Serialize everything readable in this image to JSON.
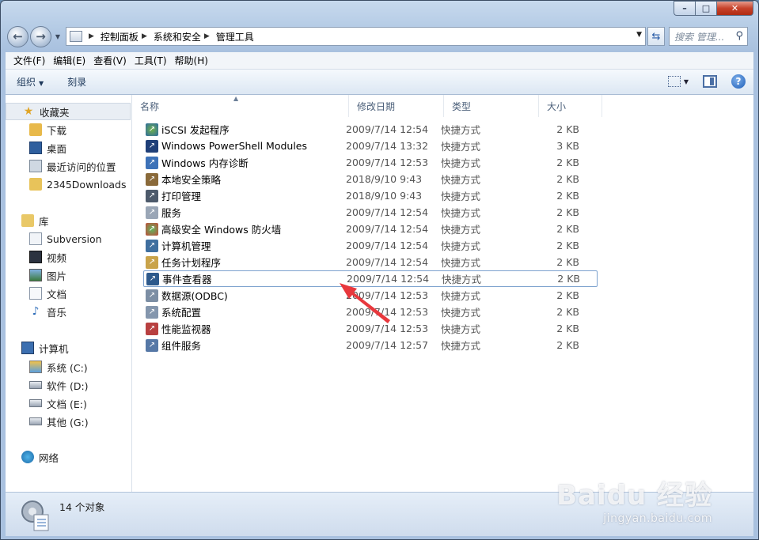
{
  "window": {
    "caption_min": "–",
    "caption_max": "□",
    "caption_close": "✕"
  },
  "address": {
    "crumbs": [
      "控制面板",
      "系统和安全",
      "管理工具"
    ],
    "search_placeholder": "搜索 管理..."
  },
  "menu": [
    "文件(F)",
    "编辑(E)",
    "查看(V)",
    "工具(T)",
    "帮助(H)"
  ],
  "commands": {
    "organize": "组织",
    "burn": "刻录"
  },
  "nav": {
    "favorites": "收藏夹",
    "favorites_items": [
      "下载",
      "桌面",
      "最近访问的位置",
      "2345Downloads"
    ],
    "libraries": "库",
    "libraries_items": [
      "Subversion",
      "视频",
      "图片",
      "文档",
      "音乐"
    ],
    "computer": "计算机",
    "computer_items": [
      "系统 (C:)",
      "软件 (D:)",
      "文档 (E:)",
      "其他 (G:)"
    ],
    "network": "网络"
  },
  "columns": [
    "名称",
    "修改日期",
    "类型",
    "大小"
  ],
  "files": [
    {
      "name": "iSCSI 发起程序",
      "date": "2009/7/14 12:54",
      "type": "快捷方式",
      "size": "2 KB"
    },
    {
      "name": "Windows PowerShell Modules",
      "date": "2009/7/14 13:32",
      "type": "快捷方式",
      "size": "3 KB"
    },
    {
      "name": "Windows 内存诊断",
      "date": "2009/7/14 12:53",
      "type": "快捷方式",
      "size": "2 KB"
    },
    {
      "name": "本地安全策略",
      "date": "2018/9/10 9:43",
      "type": "快捷方式",
      "size": "2 KB"
    },
    {
      "name": "打印管理",
      "date": "2018/9/10 9:43",
      "type": "快捷方式",
      "size": "2 KB"
    },
    {
      "name": "服务",
      "date": "2009/7/14 12:54",
      "type": "快捷方式",
      "size": "2 KB"
    },
    {
      "name": "高级安全 Windows 防火墙",
      "date": "2009/7/14 12:54",
      "type": "快捷方式",
      "size": "2 KB"
    },
    {
      "name": "计算机管理",
      "date": "2009/7/14 12:54",
      "type": "快捷方式",
      "size": "2 KB"
    },
    {
      "name": "任务计划程序",
      "date": "2009/7/14 12:54",
      "type": "快捷方式",
      "size": "2 KB"
    },
    {
      "name": "事件查看器",
      "date": "2009/7/14 12:54",
      "type": "快捷方式",
      "size": "2 KB"
    },
    {
      "name": "数据源(ODBC)",
      "date": "2009/7/14 12:53",
      "type": "快捷方式",
      "size": "2 KB"
    },
    {
      "name": "系统配置",
      "date": "2009/7/14 12:53",
      "type": "快捷方式",
      "size": "2 KB"
    },
    {
      "name": "性能监视器",
      "date": "2009/7/14 12:53",
      "type": "快捷方式",
      "size": "2 KB"
    },
    {
      "name": "组件服务",
      "date": "2009/7/14 12:57",
      "type": "快捷方式",
      "size": "2 KB"
    }
  ],
  "status": {
    "count": "14 个对象"
  },
  "watermark": {
    "brand": "Baidu 经验",
    "url": "jingyan.baidu.com"
  },
  "colors": {
    "accent": "#1e395b",
    "annotation_arrow": "#e8383d",
    "selection_border": "#7da2ce"
  }
}
